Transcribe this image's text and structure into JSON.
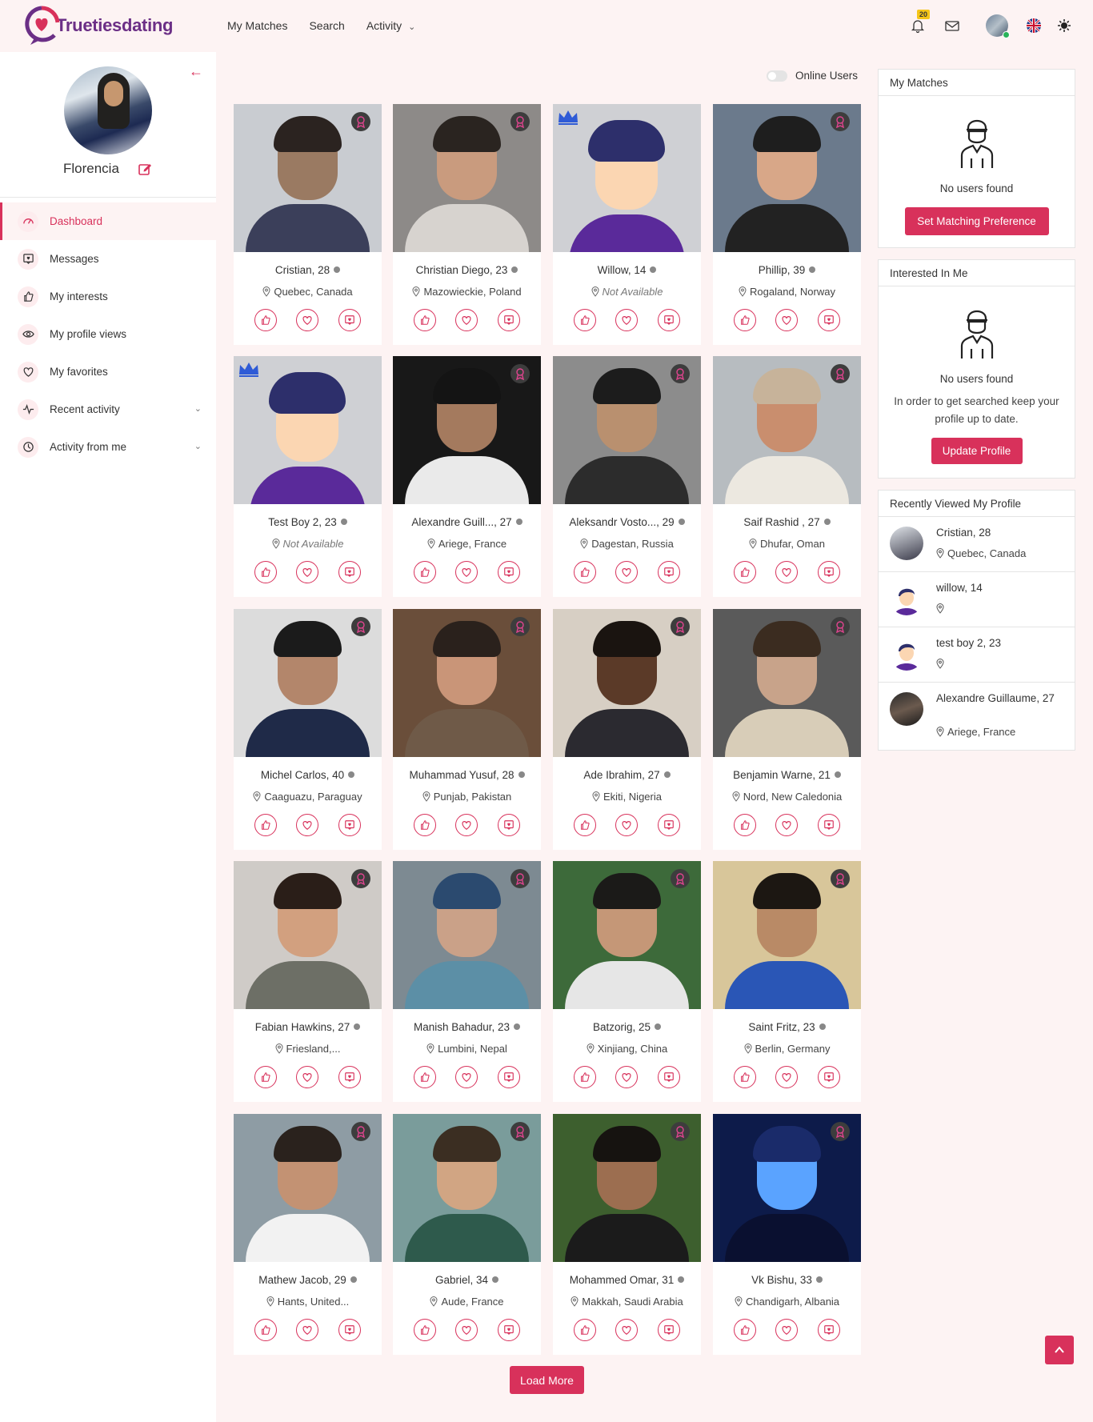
{
  "brand": {
    "name_first": "Truetiesdating",
    "accent": "#d8315b",
    "logo_purple": "#6b2f86"
  },
  "nav": {
    "items": [
      {
        "label": "My Matches"
      },
      {
        "label": "Search"
      },
      {
        "label": "Activity"
      }
    ]
  },
  "header": {
    "notification_count": "20",
    "icons": [
      "bell-icon",
      "mail-icon",
      "avatar",
      "uk-flag-icon",
      "sun-icon"
    ]
  },
  "sidebar": {
    "user_name": "Florencia",
    "menu": [
      {
        "label": "Dashboard",
        "icon": "dashboard-icon",
        "active": true
      },
      {
        "label": "Messages",
        "icon": "message-icon"
      },
      {
        "label": "My interests",
        "icon": "thumbs-up-icon"
      },
      {
        "label": "My profile views",
        "icon": "eye-icon"
      },
      {
        "label": "My favorites",
        "icon": "heart-icon"
      },
      {
        "label": "Recent activity",
        "icon": "activity-icon",
        "expandable": true
      },
      {
        "label": "Activity from me",
        "icon": "clock-icon",
        "expandable": true
      }
    ]
  },
  "filters": {
    "online_users_label": "Online Users",
    "online_users_on": false
  },
  "cards": [
    {
      "name": "Cristian, 28",
      "location": "Quebec, Canada",
      "crown": false
    },
    {
      "name": "Christian Diego, 23",
      "location": "Mazowieckie, Poland",
      "crown": false
    },
    {
      "name": "Willow, 14",
      "location": "Not Available",
      "crown": true,
      "cartoon": true,
      "na": true
    },
    {
      "name": "Phillip, 39",
      "location": "Rogaland, Norway",
      "crown": false
    },
    {
      "name": "Test Boy 2, 23",
      "location": "Not Available",
      "crown": true,
      "cartoon": true,
      "na": true
    },
    {
      "name": "Alexandre Guill..., 27",
      "location": "Ariege, France",
      "crown": false
    },
    {
      "name": "Aleksandr Vosto..., 29",
      "location": "Dagestan, Russia",
      "crown": false
    },
    {
      "name": "Saif Rashid , 27",
      "location": "Dhufar, Oman",
      "crown": false
    },
    {
      "name": "Michel Carlos, 40",
      "location": "Caaguazu, Paraguay",
      "crown": false
    },
    {
      "name": "Muhammad Yusuf, 28",
      "location": "Punjab, Pakistan",
      "crown": false
    },
    {
      "name": "Ade Ibrahim, 27",
      "location": "Ekiti, Nigeria",
      "crown": false
    },
    {
      "name": "Benjamin Warne, 21",
      "location": "Nord, New Caledonia",
      "crown": false
    },
    {
      "name": "Fabian Hawkins, 27",
      "location": "Friesland,...",
      "crown": false
    },
    {
      "name": "Manish Bahadur, 23",
      "location": "Lumbini, Nepal",
      "crown": false
    },
    {
      "name": "Batzorig, 25",
      "location": "Xinjiang, China",
      "crown": false
    },
    {
      "name": "Saint Fritz, 23",
      "location": "Berlin, Germany",
      "crown": false
    },
    {
      "name": "Mathew Jacob, 29",
      "location": "Hants, United...",
      "crown": false
    },
    {
      "name": "Gabriel, 34",
      "location": "Aude, France",
      "crown": false
    },
    {
      "name": "Mohammed Omar, 31",
      "location": "Makkah, Saudi Arabia",
      "crown": false
    },
    {
      "name": "Vk Bishu, 33",
      "location": "Chandigarh, Albania",
      "crown": false
    }
  ],
  "load_more_label": "Load More",
  "panels": {
    "my_matches": {
      "title": "My Matches",
      "empty": "No users found",
      "button": "Set Matching Preference"
    },
    "interested": {
      "title": "Interested In Me",
      "empty": "No users found",
      "help": "In order to get searched keep your profile up to date.",
      "button": "Update Profile"
    },
    "recently_viewed": {
      "title": "Recently Viewed My Profile",
      "items": [
        {
          "name": "Cristian, 28",
          "location": "Quebec, Canada"
        },
        {
          "name": "willow, 14",
          "location": ""
        },
        {
          "name": "test boy 2, 23",
          "location": ""
        },
        {
          "name": "Alexandre Guillaume, 27",
          "location": "Ariege, France"
        }
      ]
    }
  }
}
